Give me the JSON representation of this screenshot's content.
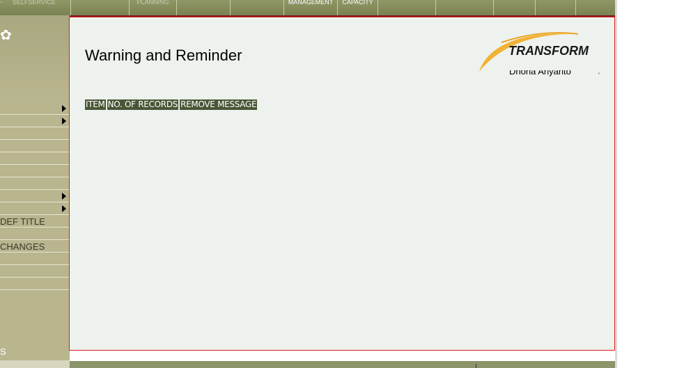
{
  "topnav": {
    "selfservice_dash": "-",
    "selfservice": "SELFSERVICE",
    "tabs": [
      "",
      "PLANNING",
      "",
      "",
      "MANAGEMENT",
      "CAPACITY",
      "",
      "",
      "",
      "",
      ""
    ]
  },
  "sidebar": {
    "decoration": "✿",
    "items": [
      {
        "label": "",
        "has_submenu": true
      },
      {
        "label": "",
        "has_submenu": true
      },
      {
        "label": "",
        "has_submenu": false
      },
      {
        "label": "",
        "has_submenu": false
      },
      {
        "label": "",
        "has_submenu": false
      },
      {
        "label": "",
        "has_submenu": false
      },
      {
        "label": "",
        "has_submenu": false
      },
      {
        "label": "",
        "has_submenu": true
      },
      {
        "label": "",
        "has_submenu": true
      },
      {
        "label": "DEF TITLE",
        "has_submenu": false
      },
      {
        "label": "",
        "has_submenu": false
      },
      {
        "label": "CHANGES",
        "has_submenu": false
      },
      {
        "label": "",
        "has_submenu": false
      },
      {
        "label": "",
        "has_submenu": false
      },
      {
        "label": "",
        "has_submenu": false
      }
    ],
    "bottom_text": "S"
  },
  "main": {
    "title": "Warning and Reminder",
    "logo_text": "TRANSFORM",
    "user_name": "Dhona Ariyanto",
    "user_tick": "'",
    "grid_columns": [
      "ITEM",
      "NO. OF RECORDS",
      "REMOVE MESSAGE"
    ]
  },
  "colors": {
    "nav_bar": "#8f9767",
    "sidebar": "#b8b58f",
    "panel_bg": "#eef2ee",
    "panel_border": "#e01818",
    "grid_header": "#4a5536",
    "logo_swoosh": "#f2b233"
  }
}
